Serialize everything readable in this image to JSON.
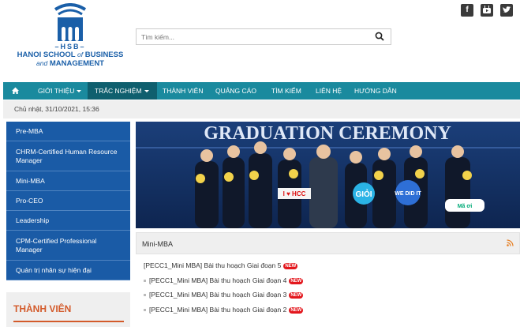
{
  "logo": {
    "sub": "HSB",
    "line1_a": "HANOI SCHOOL",
    "line1_of": "of",
    "line1_b": "BUSINESS",
    "line2_and": "and",
    "line2_b": "MANAGEMENT",
    "color": "#1a5fa8"
  },
  "search": {
    "placeholder": "Tìm kiếm...",
    "icon": "search-icon"
  },
  "social": {
    "facebook": "f",
    "youtube": "You",
    "other": "t"
  },
  "nav": {
    "home_icon": "home-icon",
    "items": [
      {
        "label": "GIỚI THIỆU",
        "has_caret": true
      },
      {
        "label": "TRẮC NGHIỆM",
        "has_caret": true,
        "active": true
      },
      {
        "label": "THÀNH VIÊN"
      },
      {
        "label": "QUẢNG CÁO"
      },
      {
        "label": "TÌM KIẾM"
      },
      {
        "label": "LIÊN HỆ"
      },
      {
        "label": "HƯỚNG DẪN"
      }
    ],
    "color": "#1a8a9e"
  },
  "date": "Chủ nhật, 31/10/2021, 15:36",
  "sidebar": {
    "items": [
      {
        "label": "Pre-MBA"
      },
      {
        "label": "CHRM-Certified Human Resource Manager"
      },
      {
        "label": "Mini-MBA"
      },
      {
        "label": "Pro-CEO"
      },
      {
        "label": "Leadership"
      },
      {
        "label": "CPM-Certified Professional Manager"
      },
      {
        "label": "Quản trị nhân sự hiện đại"
      }
    ],
    "color": "#1a5ba6"
  },
  "members": {
    "title": "THÀNH VIÊN",
    "color": "#d35a2a"
  },
  "banner": {
    "title": "GRADUATION CEREMONY",
    "sign1": "I ♥ HCC",
    "sign2": "GIỎI",
    "sign3": "WE DID IT",
    "sign4": "Mã ơi"
  },
  "panel": {
    "title": "Mini-MBA",
    "posts": [
      {
        "title": "[PECC1_Mini MBA] Bài thu hoạch Giai đoạn 5",
        "badge": "NEW"
      },
      {
        "title": "[PECC1_Mini MBA] Bài thu hoạch Giai đoạn 4",
        "badge": "NEW"
      },
      {
        "title": "[PECC1_Mini MBA] Bài thu hoạch Giai đoạn 3",
        "badge": "NEW"
      },
      {
        "title": "[PECC1_Mini MBA] Bài thu hoạch Giai đoạn 2",
        "badge": "NEW"
      }
    ]
  }
}
